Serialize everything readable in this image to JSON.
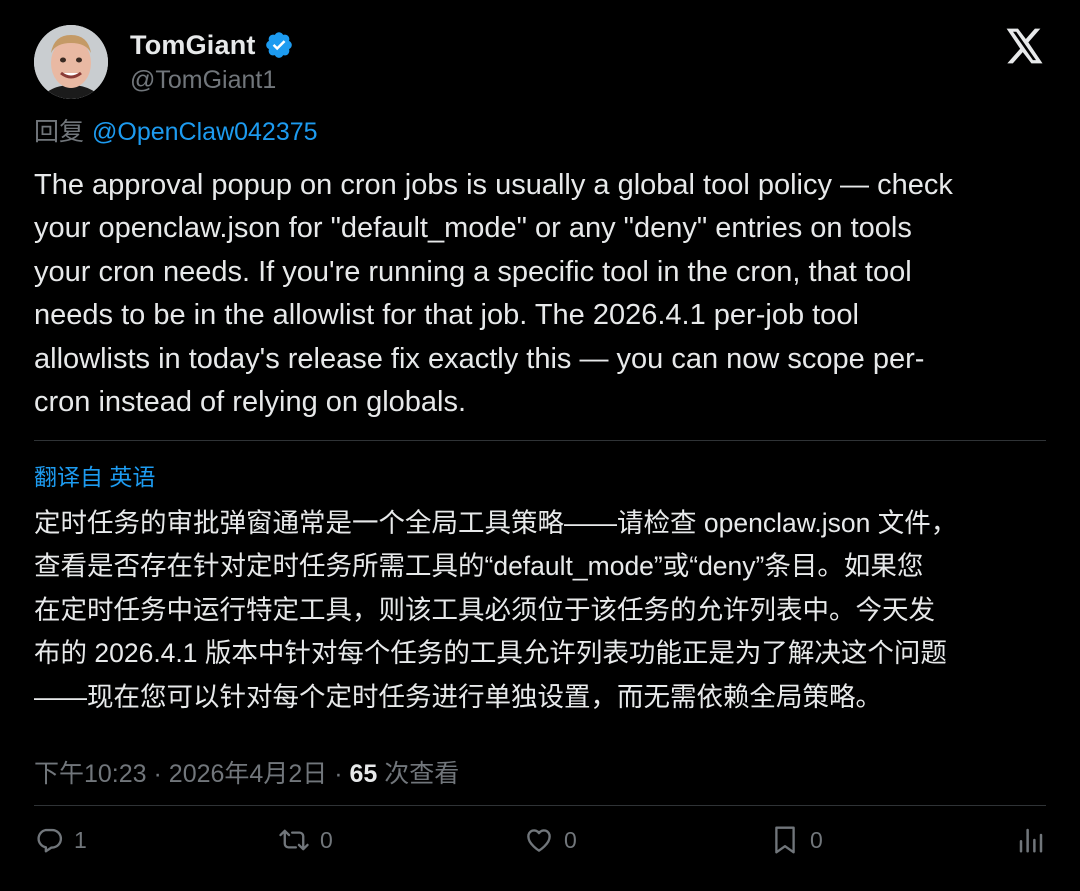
{
  "header": {
    "display_name": "TomGiant",
    "handle": "@TomGiant1",
    "verified_color": "#1d9bf0",
    "avatar_icon": "avatar",
    "logo_icon": "x-logo-icon"
  },
  "reply": {
    "prefix": "回复",
    "mention": "@OpenClaw042375"
  },
  "tweet": {
    "lines": [
      "The approval popup on cron jobs is usually a global tool policy — check",
      "your openclaw.json for \"default_mode\" or any \"deny\" entries on tools",
      "your cron needs. If you're running a specific tool in the cron, that tool",
      "needs to be in the allowlist for that job. The 2026.4.1 per-job tool",
      "allowlists in today's release fix exactly this — you can now scope per-",
      "cron instead of relying on globals."
    ]
  },
  "translation": {
    "label": "翻译自 英语",
    "lines": [
      "定时任务的审批弹窗通常是一个全局工具策略——请检查 openclaw.json 文件，",
      "查看是否存在针对定时任务所需工具的“default_mode”或“deny”条目。如果您",
      "在定时任务中运行特定工具，则该工具必须位于该任务的允许列表中。今天发",
      "布的 2026.4.1 版本中针对每个任务的工具允许列表功能正是为了解决这个问题",
      "——现在您可以针对每个定时任务进行单独设置，而无需依赖全局策略。"
    ]
  },
  "meta": {
    "time": "下午10:23",
    "separator": "·",
    "date": "2026年4月2日",
    "views_count": "65",
    "views_label": "次查看"
  },
  "actions": {
    "reply": {
      "icon": "reply-icon",
      "count": "1"
    },
    "retweet": {
      "icon": "retweet-icon",
      "count": "0"
    },
    "like": {
      "icon": "heart-icon",
      "count": "0"
    },
    "bookmark": {
      "icon": "bookmark-icon",
      "count": "0"
    },
    "analytics": {
      "icon": "analytics-icon"
    }
  },
  "colors": {
    "background": "#000000",
    "text": "#e7e9ea",
    "muted": "#71767b",
    "accent": "#1d9bf0",
    "divider": "#2f3336"
  }
}
